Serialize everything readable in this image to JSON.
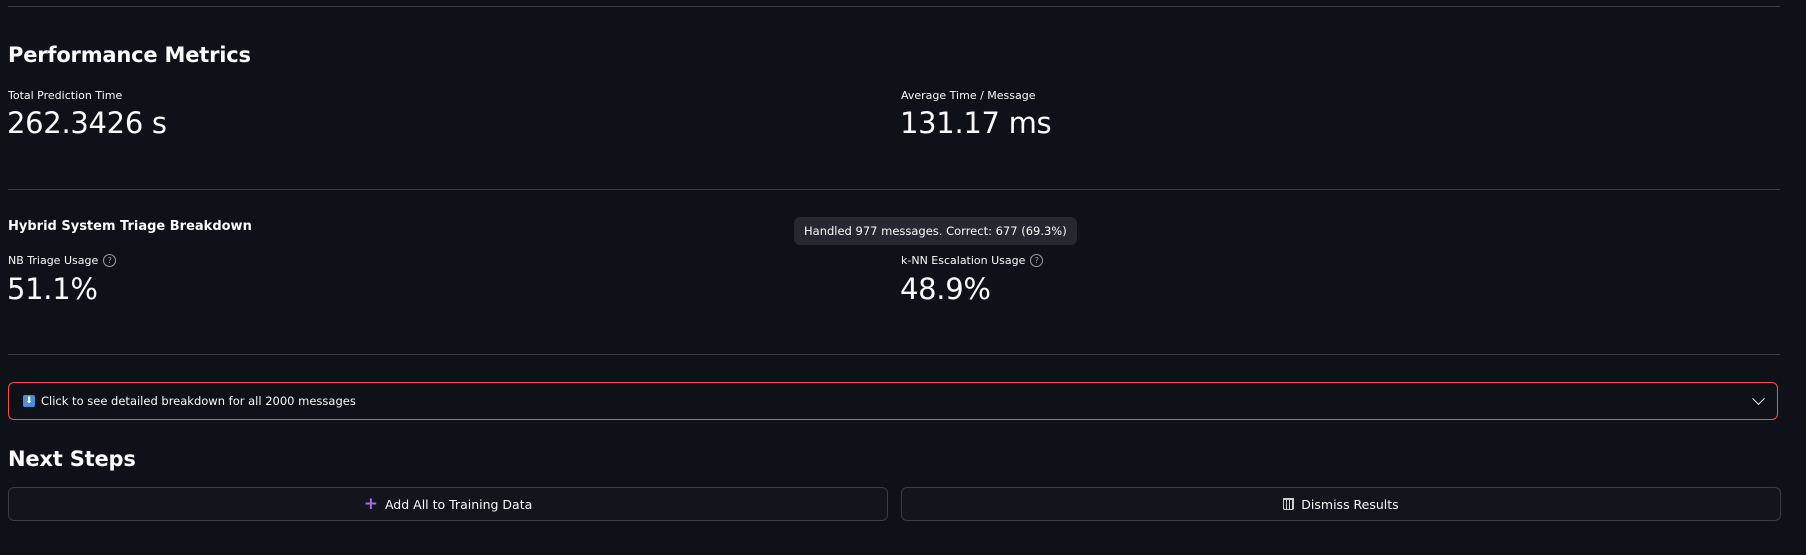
{
  "performance": {
    "title": "Performance Metrics",
    "total_time": {
      "label": "Total Prediction Time",
      "value": "262.3426 s"
    },
    "avg_time": {
      "label": "Average Time / Message",
      "value": "131.17 ms"
    }
  },
  "triage": {
    "title": "Hybrid System Triage Breakdown",
    "tooltip": "Handled 977 messages. Correct: 677 (69.3%)",
    "nb": {
      "label": "NB Triage Usage",
      "value": "51.1%"
    },
    "knn": {
      "label": "k-NN Escalation Usage",
      "value": "48.9%"
    }
  },
  "expander": {
    "icon": "down-arrow-emoji",
    "label": "Click to see detailed breakdown for all 2000 messages"
  },
  "next_steps": {
    "title": "Next Steps",
    "add_label": "Add All to Training Data",
    "dismiss_label": "Dismiss Results",
    "accent": "#a36bdc"
  },
  "colors": {
    "background": "#0e1117",
    "expander_border": "#ff4b4b"
  }
}
